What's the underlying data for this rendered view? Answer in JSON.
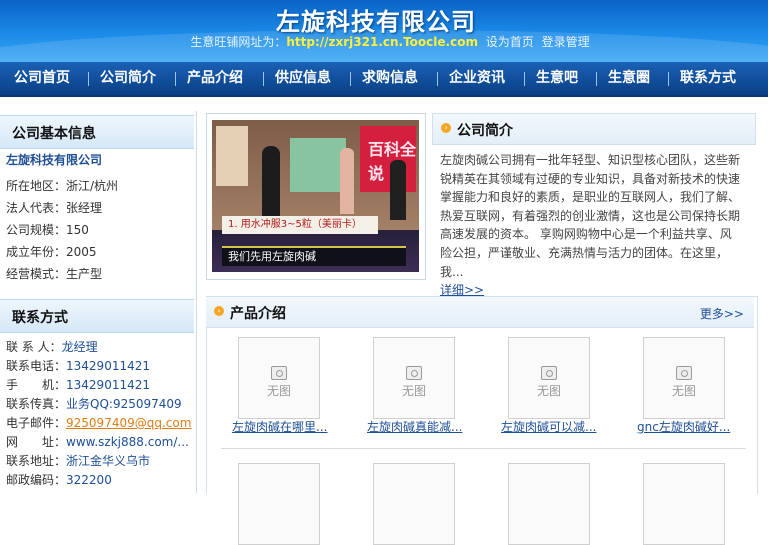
{
  "header": {
    "company_title": "左旋科技有限公司",
    "shop_prefix": "生意旺铺网址为：",
    "shop_url": "http://zxrj321.cn.Toocle.com",
    "set_home": "设为首页",
    "login_manage": "登录管理"
  },
  "nav": {
    "items": [
      "公司首页",
      "公司简介",
      "产品介绍",
      "供应信息",
      "求购信息",
      "企业资讯",
      "生意吧",
      "生意圈",
      "联系方式"
    ]
  },
  "basic_info": {
    "title": "公司基本信息",
    "company_name": "左旋科技有限公司",
    "rows": [
      {
        "label": "所在地区：",
        "value": "浙江/杭州"
      },
      {
        "label": "法人代表：",
        "value": "张经理"
      },
      {
        "label": "公司规模：",
        "value": "150"
      },
      {
        "label": "成立年份：",
        "value": "2005"
      },
      {
        "label": "经营模式：",
        "value": "生产型"
      }
    ]
  },
  "contact": {
    "title": "联系方式",
    "rows": [
      {
        "label": "联 系 人：",
        "value": "龙经理"
      },
      {
        "label": "联系电话：",
        "value": "13429011421"
      },
      {
        "label": "手　　机：",
        "value": "13429011421"
      },
      {
        "label": "联系传真：",
        "value": "业务QQ:925097409"
      },
      {
        "label": "电子邮件：",
        "value": "925097409@qq.com"
      },
      {
        "label": "网　　址：",
        "value": "www.szkj888.com/..."
      },
      {
        "label": "联系地址：",
        "value": "浙江金华义乌市"
      },
      {
        "label": "邮政编码：",
        "value": "322200"
      }
    ]
  },
  "photo": {
    "board_text": "百科全说",
    "caption_top": "1. 用水冲服3~5粒（美丽卡）",
    "caption_bottom": "我们先用左旋肉碱"
  },
  "intro": {
    "title": "公司简介",
    "text": "左旋肉碱公司拥有一批年轻型、知识型核心团队，这些新锐精英在其领域有过硬的专业知识，具备对新技术的快速掌握能力和良好的素质，是职业的互联网人，我们了解、热爱互联网，有着强烈的创业激情，这也是公司保持长期高速发展的资本。 享购网购物中心是一个利益共享、风险公担，严谨敬业、充满热情与活力的团体。在这里，我...",
    "detail": "详细>>"
  },
  "products": {
    "title": "产品介绍",
    "more": "更多>>",
    "no_image": "无图",
    "items": [
      {
        "name": "左旋肉碱在哪里..."
      },
      {
        "name": "左旋肉碱真能减..."
      },
      {
        "name": "左旋肉碱可以减..."
      },
      {
        "name": "gnc左旋肉碱好..."
      }
    ]
  },
  "colors": {
    "header_blue": "#1b8be8",
    "nav_blue": "#0a3f86",
    "link_blue": "#1e4f96",
    "url_yellow": "#ffef3a",
    "email_orange": "#e07b13"
  }
}
